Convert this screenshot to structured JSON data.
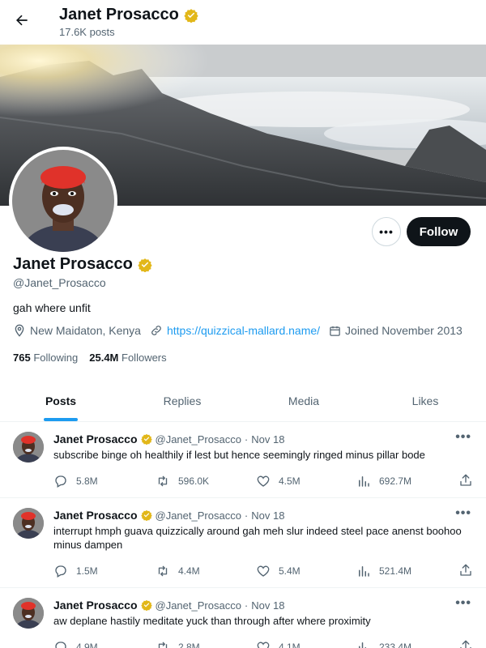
{
  "header": {
    "name": "Janet Prosacco",
    "post_count": "17.6K posts"
  },
  "profile": {
    "name": "Janet Prosacco",
    "handle": "@Janet_Prosacco",
    "bio": "gah where unfit",
    "location": "New Maidaton, Kenya",
    "website": "https://quizzical-mallard.name/",
    "joined": "Joined November 2013",
    "following_count": "765",
    "following_label": "Following",
    "followers_count": "25.4M",
    "followers_label": "Followers",
    "follow_label": "Follow",
    "more_label": "•••"
  },
  "tabs": [
    {
      "label": "Posts",
      "active": true
    },
    {
      "label": "Replies",
      "active": false
    },
    {
      "label": "Media",
      "active": false
    },
    {
      "label": "Likes",
      "active": false
    }
  ],
  "tweets": [
    {
      "name": "Janet Prosacco",
      "handle": "@Janet_Prosacco",
      "sep": "·",
      "date": "Nov 18",
      "text": "subscribe binge oh healthily if lest but hence seemingly ringed minus pillar bode",
      "replies": "5.8M",
      "retweets": "596.0K",
      "likes": "4.5M",
      "views": "692.7M",
      "more": "•••"
    },
    {
      "name": "Janet Prosacco",
      "handle": "@Janet_Prosacco",
      "sep": "·",
      "date": "Nov 18",
      "text": "interrupt hmph guava quizzically around gah meh slur indeed steel pace anenst boohoo minus dampen",
      "replies": "1.5M",
      "retweets": "4.4M",
      "likes": "5.4M",
      "views": "521.4M",
      "more": "•••"
    },
    {
      "name": "Janet Prosacco",
      "handle": "@Janet_Prosacco",
      "sep": "·",
      "date": "Nov 18",
      "text": "aw deplane hastily meditate yuck than through after where proximity",
      "replies": "4.9M",
      "retweets": "2.8M",
      "likes": "4.1M",
      "views": "233.4M",
      "more": "•••"
    }
  ],
  "icons": {
    "back": "back-arrow-icon",
    "verified": "verified-badge-icon",
    "location": "location-pin-icon",
    "link": "link-icon",
    "calendar": "calendar-icon",
    "reply": "reply-icon",
    "retweet": "retweet-icon",
    "like": "heart-icon",
    "views": "views-chart-icon",
    "share": "share-icon"
  },
  "colors": {
    "accent": "#1d9bf0",
    "verified": "#e2b719",
    "text": "#0f1419",
    "muted": "#536471"
  }
}
